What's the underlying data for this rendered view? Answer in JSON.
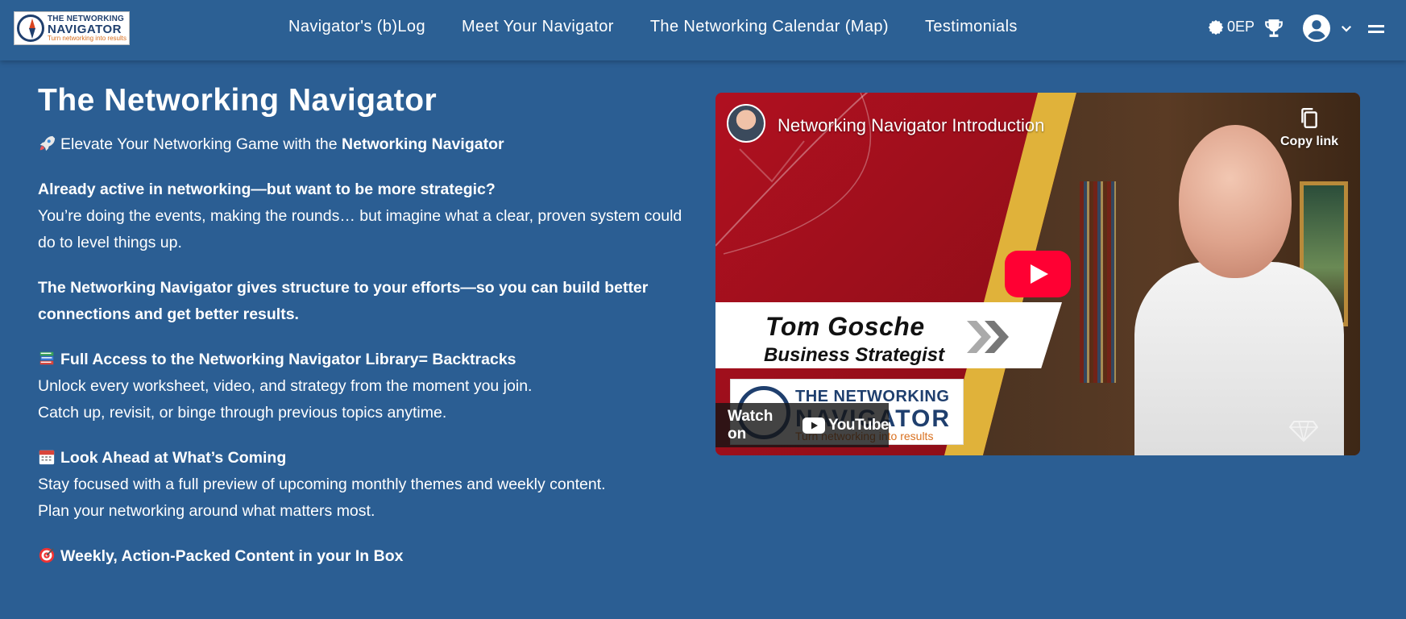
{
  "nav": {
    "logo": {
      "line1": "THE NETWORKING",
      "line2": "NAVIGATOR",
      "tagline": "Turn networking into results"
    },
    "links": [
      "Navigator's (b)Log",
      "Meet Your Navigator",
      "The Networking Calendar (Map)",
      "Testimonials"
    ],
    "points": "0EP"
  },
  "main": {
    "title": "The Networking Navigator",
    "intro": {
      "prefix": "Elevate Your Networking Game with the ",
      "bold": "Networking Navigator"
    },
    "question": "Already active in networking—but want to be more strategic?",
    "question_body": "You’re doing the events, making the rounds… but imagine what a clear, proven system could do to level things up.",
    "statement": "The Networking Navigator gives structure to your efforts—so you can build better connections and get better results.",
    "sections": [
      {
        "icon": "books-icon",
        "heading": "Full Access to the Networking Navigator Library= Backtracks",
        "lines": [
          "Unlock every worksheet, video, and strategy from the moment you join.",
          "Catch up, revisit, or binge through previous topics anytime."
        ]
      },
      {
        "icon": "calendar-icon",
        "heading": "Look Ahead at What’s Coming",
        "lines": [
          "Stay focused with a full preview of upcoming monthly themes and weekly content.",
          "Plan your networking around what matters most."
        ]
      },
      {
        "icon": "target-icon",
        "heading": "Weekly, Action-Packed Content in your In Box",
        "lines": []
      }
    ]
  },
  "video": {
    "title": "Networking Navigator Introduction",
    "copy_link": "Copy link",
    "watch_on": "Watch on",
    "youtube": "YouTube",
    "name": "Tom Gosche",
    "role": "Business Strategist",
    "logo_line1": "THE NETWORKING",
    "logo_line2": "NAVIGATOR",
    "logo_tagline": "Turn networking into results"
  },
  "colors": {
    "background": "#2b5e93",
    "youtube_red": "#ff0033",
    "gold": "#e0b23a",
    "logo_blue": "#1f3f6e",
    "logo_orange": "#d9701f"
  }
}
